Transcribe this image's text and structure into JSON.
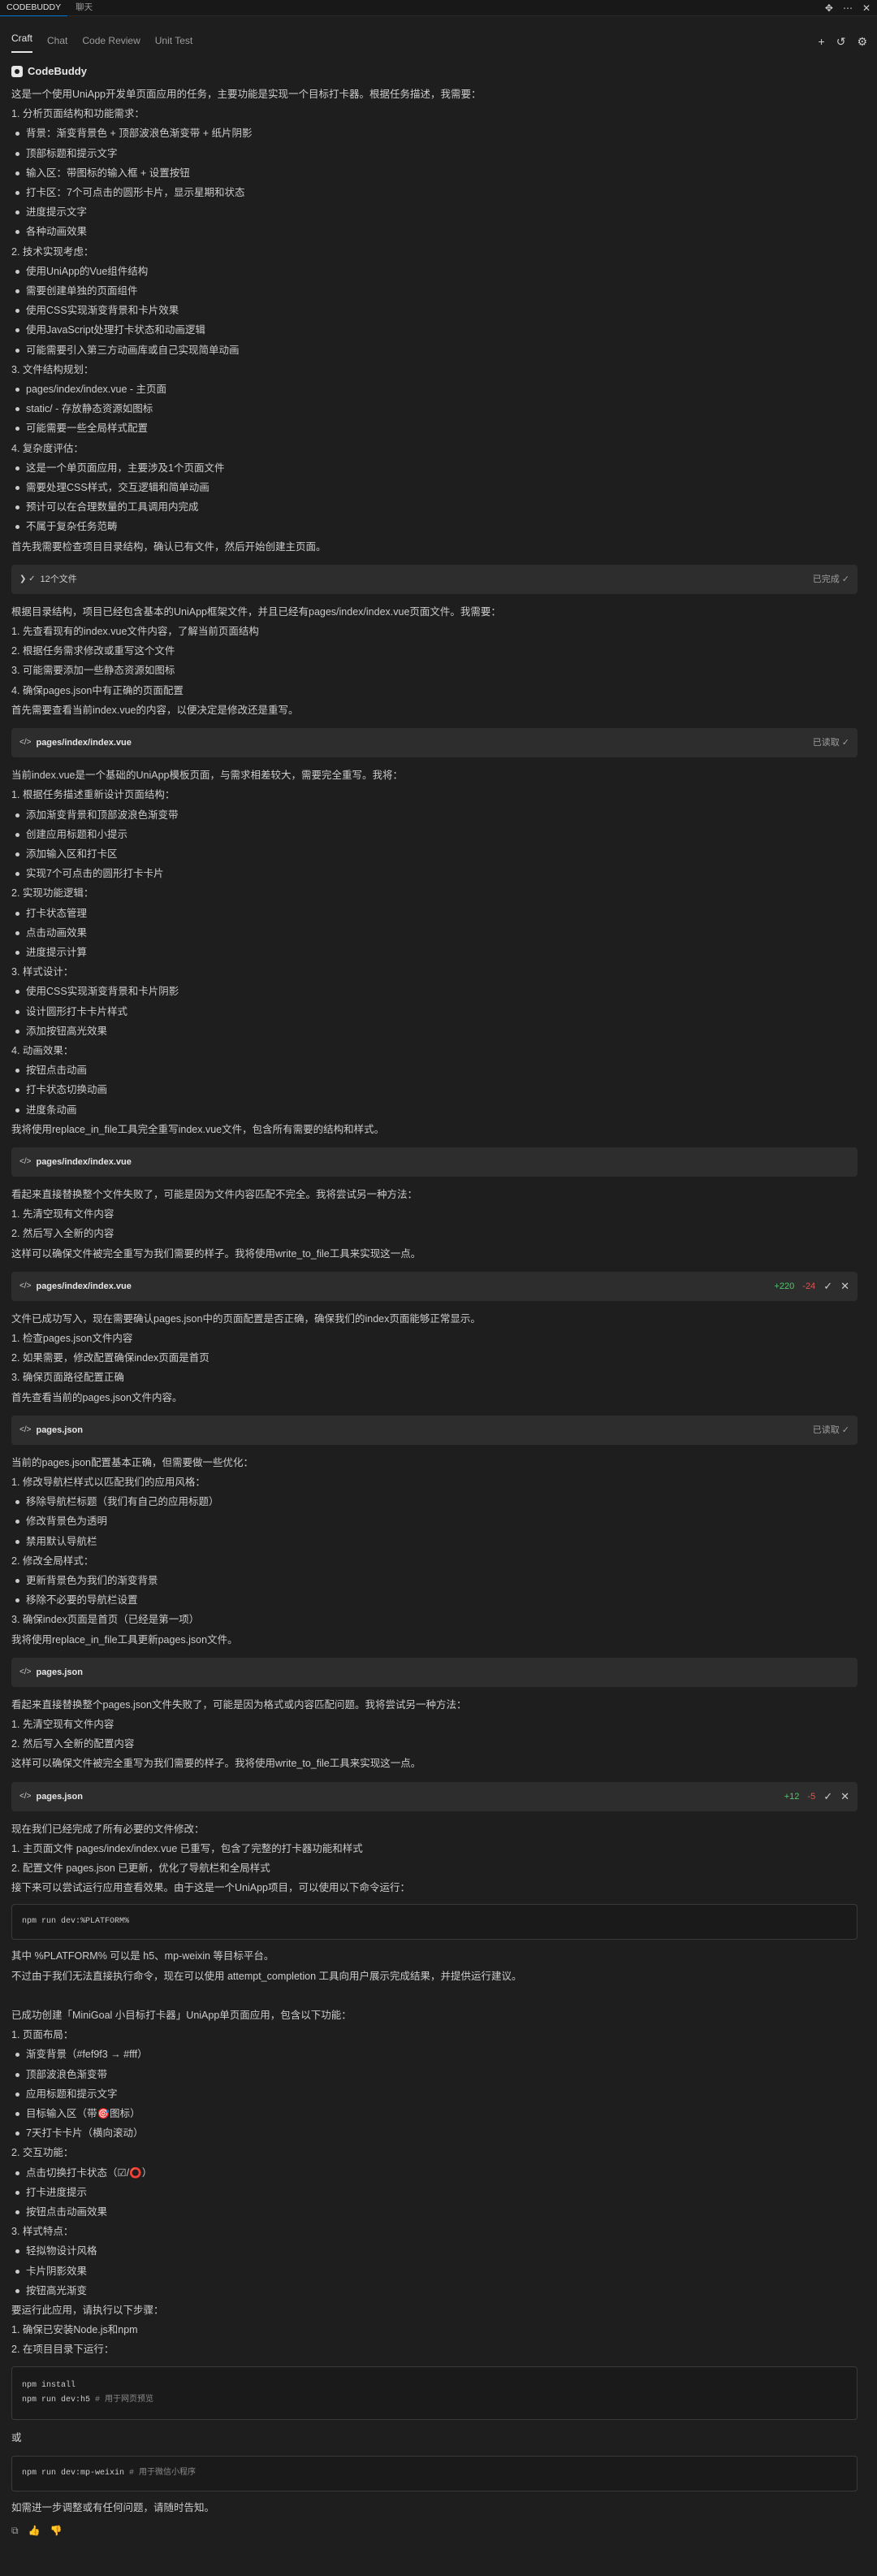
{
  "topbar": {
    "tab_main": "CODEBUDDY",
    "tab_chat": "聊天",
    "icons": [
      "move-icon",
      "ellipsis-icon",
      "close-icon"
    ]
  },
  "tabs": {
    "items": [
      "Craft",
      "Chat",
      "Code Review",
      "Unit Test"
    ],
    "active": "Craft"
  },
  "brand": {
    "name": "CodeBuddy"
  },
  "s1": {
    "intro": "这是一个使用UniApp开发单页面应用的任务，主要功能是实现一个目标打卡器。根据任务描述，我需要：",
    "items": [
      {
        "t": "p",
        "v": "1. 分析页面结构和功能需求："
      },
      {
        "t": "li",
        "v": "背景：渐变背景色 + 顶部波浪色渐变带 + 纸片阴影"
      },
      {
        "t": "li",
        "v": "顶部标题和提示文字"
      },
      {
        "t": "li",
        "v": "输入区：带图标的输入框 + 设置按钮"
      },
      {
        "t": "li",
        "v": "打卡区：7个可点击的圆形卡片，显示星期和状态"
      },
      {
        "t": "li",
        "v": "进度提示文字"
      },
      {
        "t": "li",
        "v": "各种动画效果"
      },
      {
        "t": "p",
        "v": "2. 技术实现考虑："
      },
      {
        "t": "li",
        "v": "使用UniApp的Vue组件结构"
      },
      {
        "t": "li",
        "v": "需要创建单独的页面组件"
      },
      {
        "t": "li",
        "v": "使用CSS实现渐变背景和卡片效果"
      },
      {
        "t": "li",
        "v": "使用JavaScript处理打卡状态和动画逻辑"
      },
      {
        "t": "li",
        "v": "可能需要引入第三方动画库或自己实现简单动画"
      },
      {
        "t": "p",
        "v": "3. 文件结构规划："
      },
      {
        "t": "li",
        "v": "pages/index/index.vue - 主页面"
      },
      {
        "t": "li",
        "v": "static/ - 存放静态资源如图标"
      },
      {
        "t": "li",
        "v": "可能需要一些全局样式配置"
      },
      {
        "t": "p",
        "v": "4. 复杂度评估："
      },
      {
        "t": "li",
        "v": "这是一个单页面应用，主要涉及1个页面文件"
      },
      {
        "t": "li",
        "v": "需要处理CSS样式，交互逻辑和简单动画"
      },
      {
        "t": "li",
        "v": "预计可以在合理数量的工具调用内完成"
      },
      {
        "t": "li",
        "v": "不属于复杂任务范畴"
      },
      {
        "t": "p",
        "v": "首先我需要检查项目目录结构，确认已有文件，然后开始创建主页面。"
      }
    ]
  },
  "bar1": {
    "label": "12个文件",
    "status": "已完成 ✓"
  },
  "s2": {
    "items": [
      {
        "t": "p",
        "v": "根据目录结构，项目已经包含基本的UniApp框架文件，并且已经有pages/index/index.vue页面文件。我需要："
      },
      {
        "t": "p",
        "v": "1. 先查看现有的index.vue文件内容，了解当前页面结构"
      },
      {
        "t": "p",
        "v": "2. 根据任务需求修改或重写这个文件"
      },
      {
        "t": "p",
        "v": "3. 可能需要添加一些静态资源如图标"
      },
      {
        "t": "p",
        "v": "4. 确保pages.json中有正确的页面配置"
      },
      {
        "t": "p",
        "v": "首先需要查看当前index.vue的内容，以便决定是修改还是重写。"
      }
    ]
  },
  "bar2": {
    "label": "pages/index/index.vue",
    "status": "已读取 ✓"
  },
  "s3": {
    "items": [
      {
        "t": "p",
        "v": "当前index.vue是一个基础的UniApp模板页面，与需求相差较大，需要完全重写。我将："
      },
      {
        "t": "p",
        "v": "1. 根据任务描述重新设计页面结构："
      },
      {
        "t": "li",
        "v": "添加渐变背景和顶部波浪色渐变带"
      },
      {
        "t": "li",
        "v": "创建应用标题和小提示"
      },
      {
        "t": "li",
        "v": "添加输入区和打卡区"
      },
      {
        "t": "li",
        "v": "实现7个可点击的圆形打卡卡片"
      },
      {
        "t": "p",
        "v": "2. 实现功能逻辑："
      },
      {
        "t": "li",
        "v": "打卡状态管理"
      },
      {
        "t": "li",
        "v": "点击动画效果"
      },
      {
        "t": "li",
        "v": "进度提示计算"
      },
      {
        "t": "p",
        "v": "3. 样式设计："
      },
      {
        "t": "li",
        "v": "使用CSS实现渐变背景和卡片阴影"
      },
      {
        "t": "li",
        "v": "设计圆形打卡卡片样式"
      },
      {
        "t": "li",
        "v": "添加按钮高光效果"
      },
      {
        "t": "p",
        "v": "4. 动画效果："
      },
      {
        "t": "li",
        "v": "按钮点击动画"
      },
      {
        "t": "li",
        "v": "打卡状态切换动画"
      },
      {
        "t": "li",
        "v": "进度条动画"
      },
      {
        "t": "p",
        "v": "我将使用replace_in_file工具完全重写index.vue文件，包含所有需要的结构和样式。"
      }
    ]
  },
  "bar3": {
    "label": "pages/index/index.vue"
  },
  "s4": {
    "items": [
      {
        "t": "p",
        "v": "看起来直接替换整个文件失败了，可能是因为文件内容匹配不完全。我将尝试另一种方法："
      },
      {
        "t": "p",
        "v": "1. 先清空现有文件内容"
      },
      {
        "t": "p",
        "v": "2. 然后写入全新的内容"
      },
      {
        "t": "p",
        "v": "这样可以确保文件被完全重写为我们需要的样子。我将使用write_to_file工具来实现这一点。"
      }
    ]
  },
  "bar4": {
    "label": "pages/index/index.vue",
    "add": "+220",
    "del": "-24"
  },
  "s5": {
    "items": [
      {
        "t": "p",
        "v": "文件已成功写入，现在需要确认pages.json中的页面配置是否正确，确保我们的index页面能够正常显示。"
      },
      {
        "t": "p",
        "v": "1. 检查pages.json文件内容"
      },
      {
        "t": "p",
        "v": "2. 如果需要，修改配置确保index页面是首页"
      },
      {
        "t": "p",
        "v": "3. 确保页面路径配置正确"
      },
      {
        "t": "p",
        "v": "首先查看当前的pages.json文件内容。"
      }
    ]
  },
  "bar5": {
    "label": "pages.json",
    "status": "已读取 ✓"
  },
  "s6": {
    "items": [
      {
        "t": "p",
        "v": "当前的pages.json配置基本正确，但需要做一些优化："
      },
      {
        "t": "p",
        "v": "1. 修改导航栏样式以匹配我们的应用风格："
      },
      {
        "t": "li",
        "v": "移除导航栏标题（我们有自己的应用标题）"
      },
      {
        "t": "li",
        "v": "修改背景色为透明"
      },
      {
        "t": "li",
        "v": "禁用默认导航栏"
      },
      {
        "t": "p",
        "v": "2. 修改全局样式："
      },
      {
        "t": "li",
        "v": "更新背景色为我们的渐变背景"
      },
      {
        "t": "li",
        "v": "移除不必要的导航栏设置"
      },
      {
        "t": "p",
        "v": "3. 确保index页面是首页（已经是第一项）"
      },
      {
        "t": "p",
        "v": "我将使用replace_in_file工具更新pages.json文件。"
      }
    ]
  },
  "bar6": {
    "label": "pages.json"
  },
  "s7": {
    "items": [
      {
        "t": "p",
        "v": "看起来直接替换整个pages.json文件失败了，可能是因为格式或内容匹配问题。我将尝试另一种方法："
      },
      {
        "t": "p",
        "v": "1. 先清空现有文件内容"
      },
      {
        "t": "p",
        "v": "2. 然后写入全新的配置内容"
      },
      {
        "t": "p",
        "v": "这样可以确保文件被完全重写为我们需要的样子。我将使用write_to_file工具来实现这一点。"
      }
    ]
  },
  "bar7": {
    "label": "pages.json",
    "add": "+12",
    "del": "-5"
  },
  "s8": {
    "items": [
      {
        "t": "p",
        "v": "现在我们已经完成了所有必要的文件修改："
      },
      {
        "t": "p",
        "v": "1. 主页面文件 pages/index/index.vue 已重写，包含了完整的打卡器功能和样式"
      },
      {
        "t": "p",
        "v": "2. 配置文件 pages.json 已更新，优化了导航栏和全局样式"
      },
      {
        "t": "p",
        "v": "接下来可以尝试运行应用查看效果。由于这是一个UniApp项目，可以使用以下命令运行："
      }
    ]
  },
  "code1": {
    "line": "npm run dev:%PLATFORM%"
  },
  "s9": {
    "items": [
      {
        "t": "p",
        "v": "其中 %PLATFORM% 可以是 h5、mp-weixin 等目标平台。"
      },
      {
        "t": "p",
        "v": "不过由于我们无法直接执行命令，现在可以使用 attempt_completion 工具向用户展示完成结果，并提供运行建议。"
      },
      {
        "t": "p",
        "v": ""
      },
      {
        "t": "p",
        "v": "已成功创建「MiniGoal 小目标打卡器」UniApp单页面应用，包含以下功能："
      },
      {
        "t": "p",
        "v": "1. 页面布局："
      },
      {
        "t": "li",
        "v": "渐变背景（#fef9f3 → #fff）"
      },
      {
        "t": "li",
        "v": "顶部波浪色渐变带"
      },
      {
        "t": "li",
        "v": "应用标题和提示文字"
      },
      {
        "t": "li",
        "v": "目标输入区（带🎯图标）"
      },
      {
        "t": "li",
        "v": "7天打卡卡片（横向滚动）"
      },
      {
        "t": "p",
        "v": "2. 交互功能："
      },
      {
        "t": "li",
        "v": "点击切换打卡状态（☑/⭕）"
      },
      {
        "t": "li",
        "v": "打卡进度提示"
      },
      {
        "t": "li",
        "v": "按钮点击动画效果"
      },
      {
        "t": "p",
        "v": "3. 样式特点："
      },
      {
        "t": "li",
        "v": "轻拟物设计风格"
      },
      {
        "t": "li",
        "v": "卡片阴影效果"
      },
      {
        "t": "li",
        "v": "按钮高光渐变"
      },
      {
        "t": "p",
        "v": "要运行此应用，请执行以下步骤："
      },
      {
        "t": "p",
        "v": "1. 确保已安装Node.js和npm"
      },
      {
        "t": "p",
        "v": "2. 在项目目录下运行："
      }
    ]
  },
  "code2": {
    "l1": "npm install",
    "l2": "npm run dev:h5",
    "c2": "# 用于网页预览"
  },
  "or_text": "或",
  "code3": {
    "l1": "npm run dev:mp-weixin",
    "c1": "# 用于微信小程序"
  },
  "final_text": "如需进一步调整或有任何问题，请随时告知。"
}
